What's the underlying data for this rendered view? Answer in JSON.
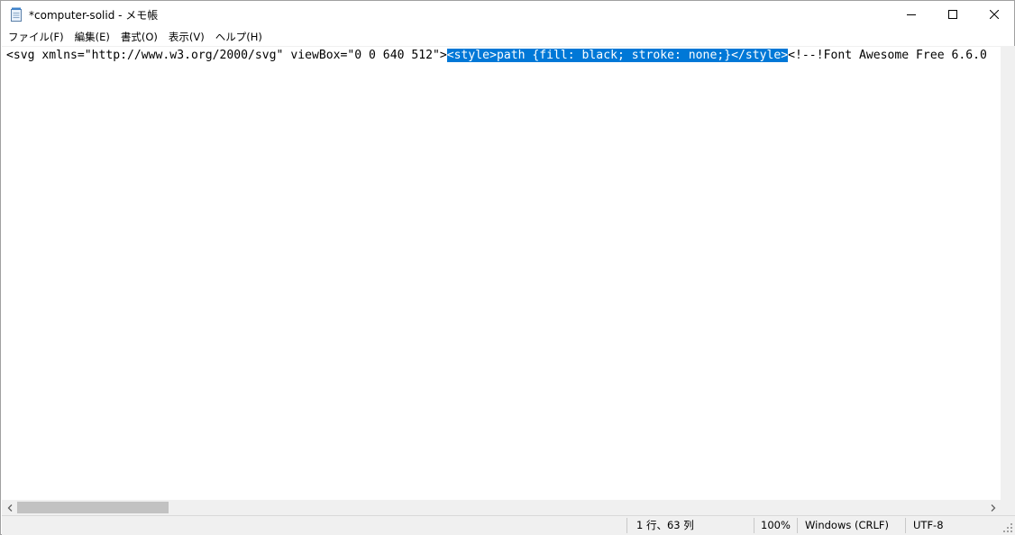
{
  "window": {
    "title": "*computer-solid - メモ帳"
  },
  "menu": {
    "items": [
      {
        "label": "ファイル(F)"
      },
      {
        "label": "編集(E)"
      },
      {
        "label": "書式(O)"
      },
      {
        "label": "表示(V)"
      },
      {
        "label": "ヘルプ(H)"
      }
    ]
  },
  "editor": {
    "before_selection": "<svg xmlns=\"http://www.w3.org/2000/svg\" viewBox=\"0 0 640 512\">",
    "selection": "<style>path {fill: black; stroke: none;}</style>",
    "after_selection": "<!--!Font Awesome Free 6.6.0"
  },
  "status": {
    "position": "1 行、63 列",
    "zoom": "100%",
    "line_ending": "Windows (CRLF)",
    "encoding": "UTF-8"
  },
  "colors": {
    "selection_bg": "#0078d7",
    "selection_fg": "#ffffff",
    "chrome_bg": "#f0f0f0",
    "scroll_thumb": "#c2c2c2"
  },
  "icons": {
    "app": "notepad-icon",
    "minimize": "minimize-icon",
    "maximize": "maximize-icon",
    "close": "close-icon",
    "scroll_left": "chevron-left-icon",
    "scroll_right": "chevron-right-icon",
    "grip": "resize-grip-icon"
  }
}
